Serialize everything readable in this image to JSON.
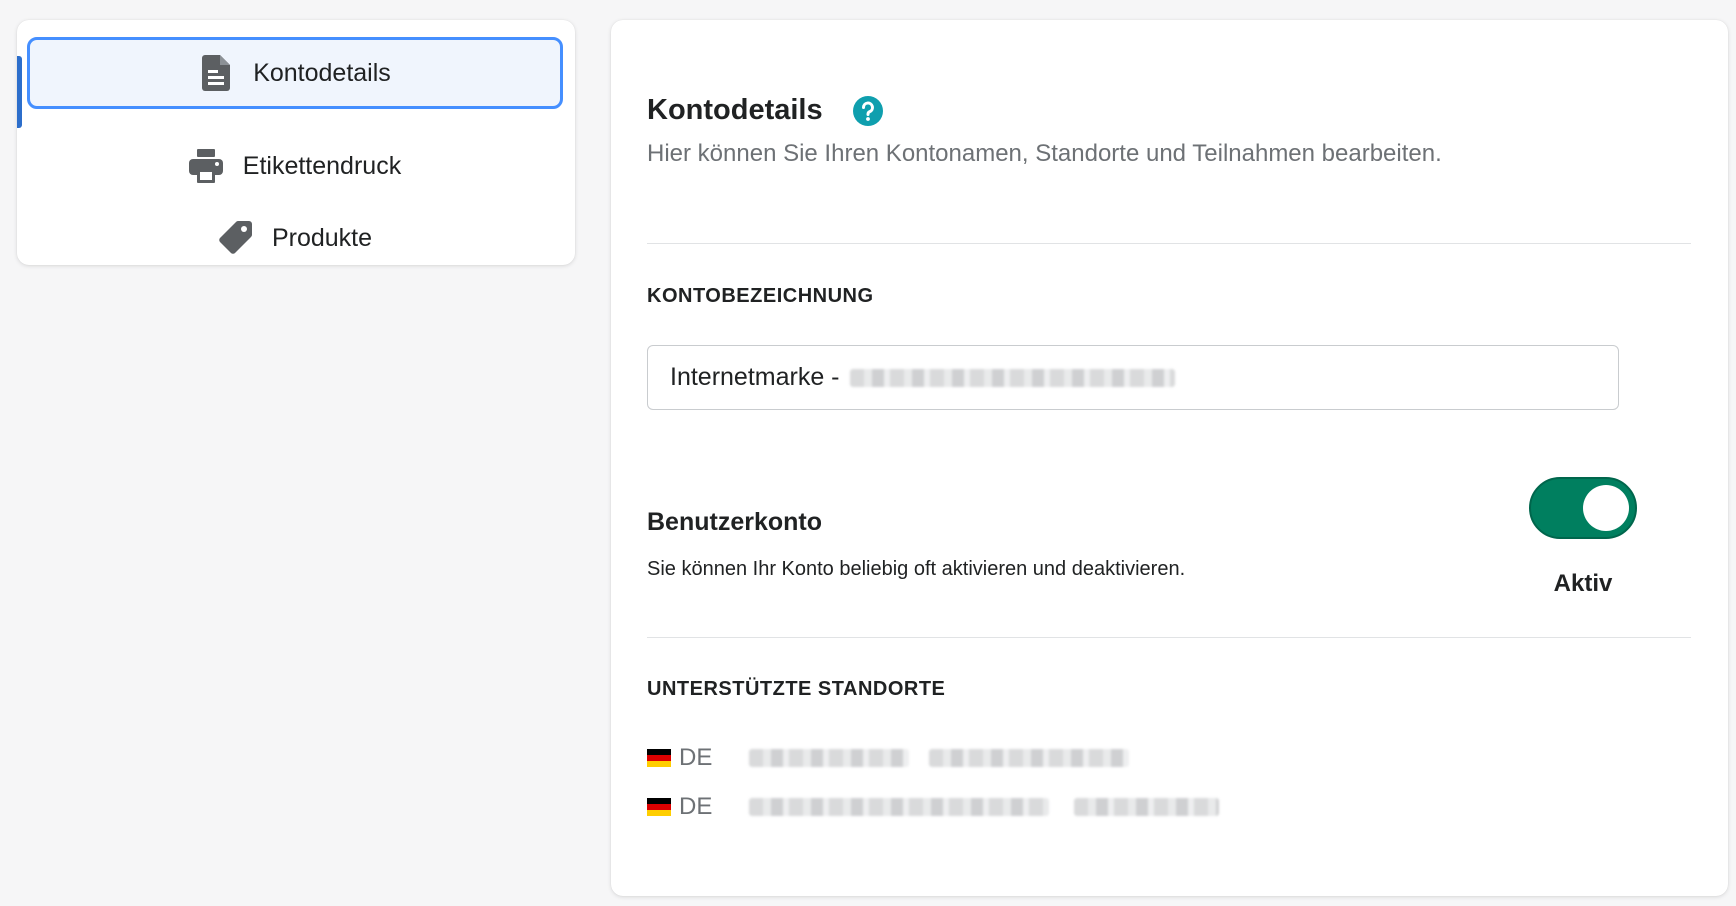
{
  "sidebar": {
    "items": [
      {
        "label": "Kontodetails",
        "icon": "document-icon",
        "active": true
      },
      {
        "label": "Etikettendruck",
        "icon": "printer-icon",
        "active": false
      },
      {
        "label": "Produkte",
        "icon": "tag-icon",
        "active": false
      }
    ]
  },
  "header": {
    "title": "Kontodetails",
    "subtitle": "Hier können Sie Ihren Kontonamen, Standorte und Teilnahmen bearbeiten."
  },
  "account_name": {
    "label": "KONTOBEZEICHNUNG",
    "value": "Internetmarke -"
  },
  "user_account": {
    "title": "Benutzerkonto",
    "description": "Sie können Ihr Konto beliebig oft aktivieren und deaktivieren.",
    "toggle_label": "Aktiv",
    "toggle_on": true
  },
  "locations": {
    "label": "UNTERSTÜTZTE STANDORTE",
    "items": [
      {
        "code": "DE"
      },
      {
        "code": "DE"
      }
    ]
  },
  "colors": {
    "accent": "#2c6ecb",
    "toggle_on": "#007f5f",
    "help": "#0f9fae"
  }
}
